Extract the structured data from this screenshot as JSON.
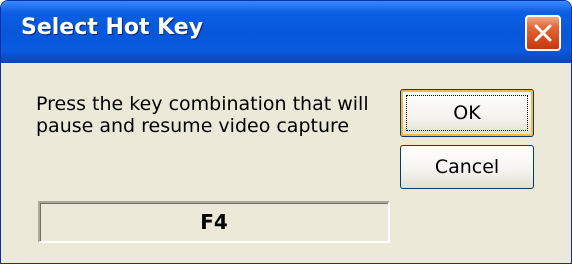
{
  "window": {
    "title": "Select Hot Key",
    "close_icon": "close-icon"
  },
  "dialog": {
    "prompt_line1": "Press the key combination that will",
    "prompt_line2": "pause and resume video capture",
    "hotkey_value": "F4",
    "ok_label": "OK",
    "cancel_label": "Cancel"
  },
  "colors": {
    "titlebar": "#0757da",
    "close_button": "#d54a1c",
    "face": "#ece9d8",
    "default_button_highlight": "#f8b940"
  }
}
